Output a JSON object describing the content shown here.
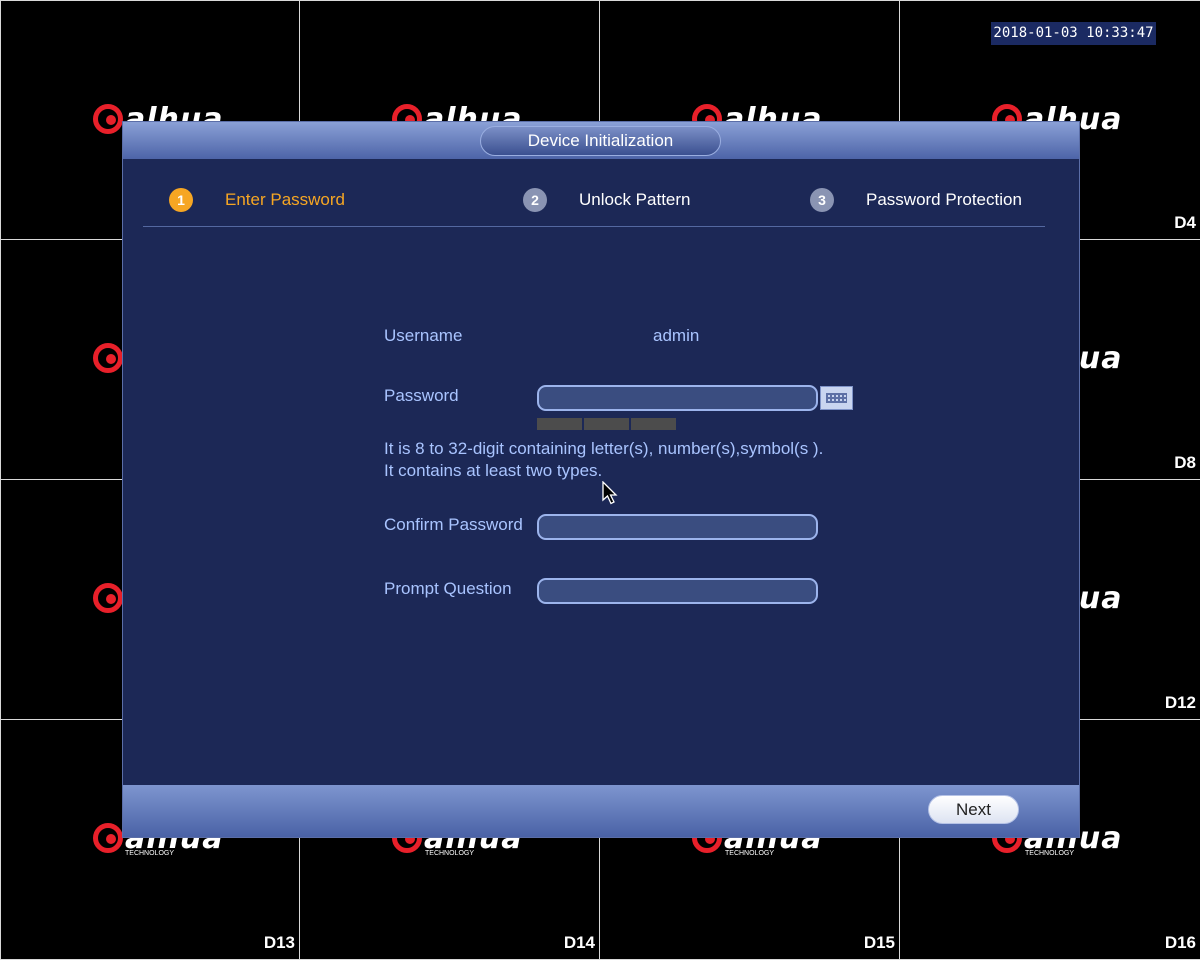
{
  "timestamp": "2018-01-03 10:33:47",
  "logo": {
    "brand": "alhua",
    "sub": "TECHNOLOGY"
  },
  "channels": {
    "d4": "D4",
    "d8": "D8",
    "d12": "D12",
    "d13": "D13",
    "d14": "D14",
    "d15": "D15",
    "d16": "D16"
  },
  "dialog": {
    "title": "Device Initialization",
    "steps": [
      {
        "num": "1",
        "label": "Enter Password",
        "active": true
      },
      {
        "num": "2",
        "label": "Unlock Pattern",
        "active": false
      },
      {
        "num": "3",
        "label": "Password Protection",
        "active": false
      }
    ],
    "form": {
      "username_label": "Username",
      "username_value": "admin",
      "password_label": "Password",
      "password_value": "",
      "hint": "It is 8 to 32-digit containing letter(s), number(s),symbol(s ). It contains at least two types.",
      "confirm_label": "Confirm Password",
      "confirm_value": "",
      "prompt_label": "Prompt Question",
      "prompt_value": ""
    },
    "next_label": "Next"
  },
  "icons": {
    "keyboard": "keyboard-icon",
    "cursor": "mouse-pointer-icon"
  }
}
